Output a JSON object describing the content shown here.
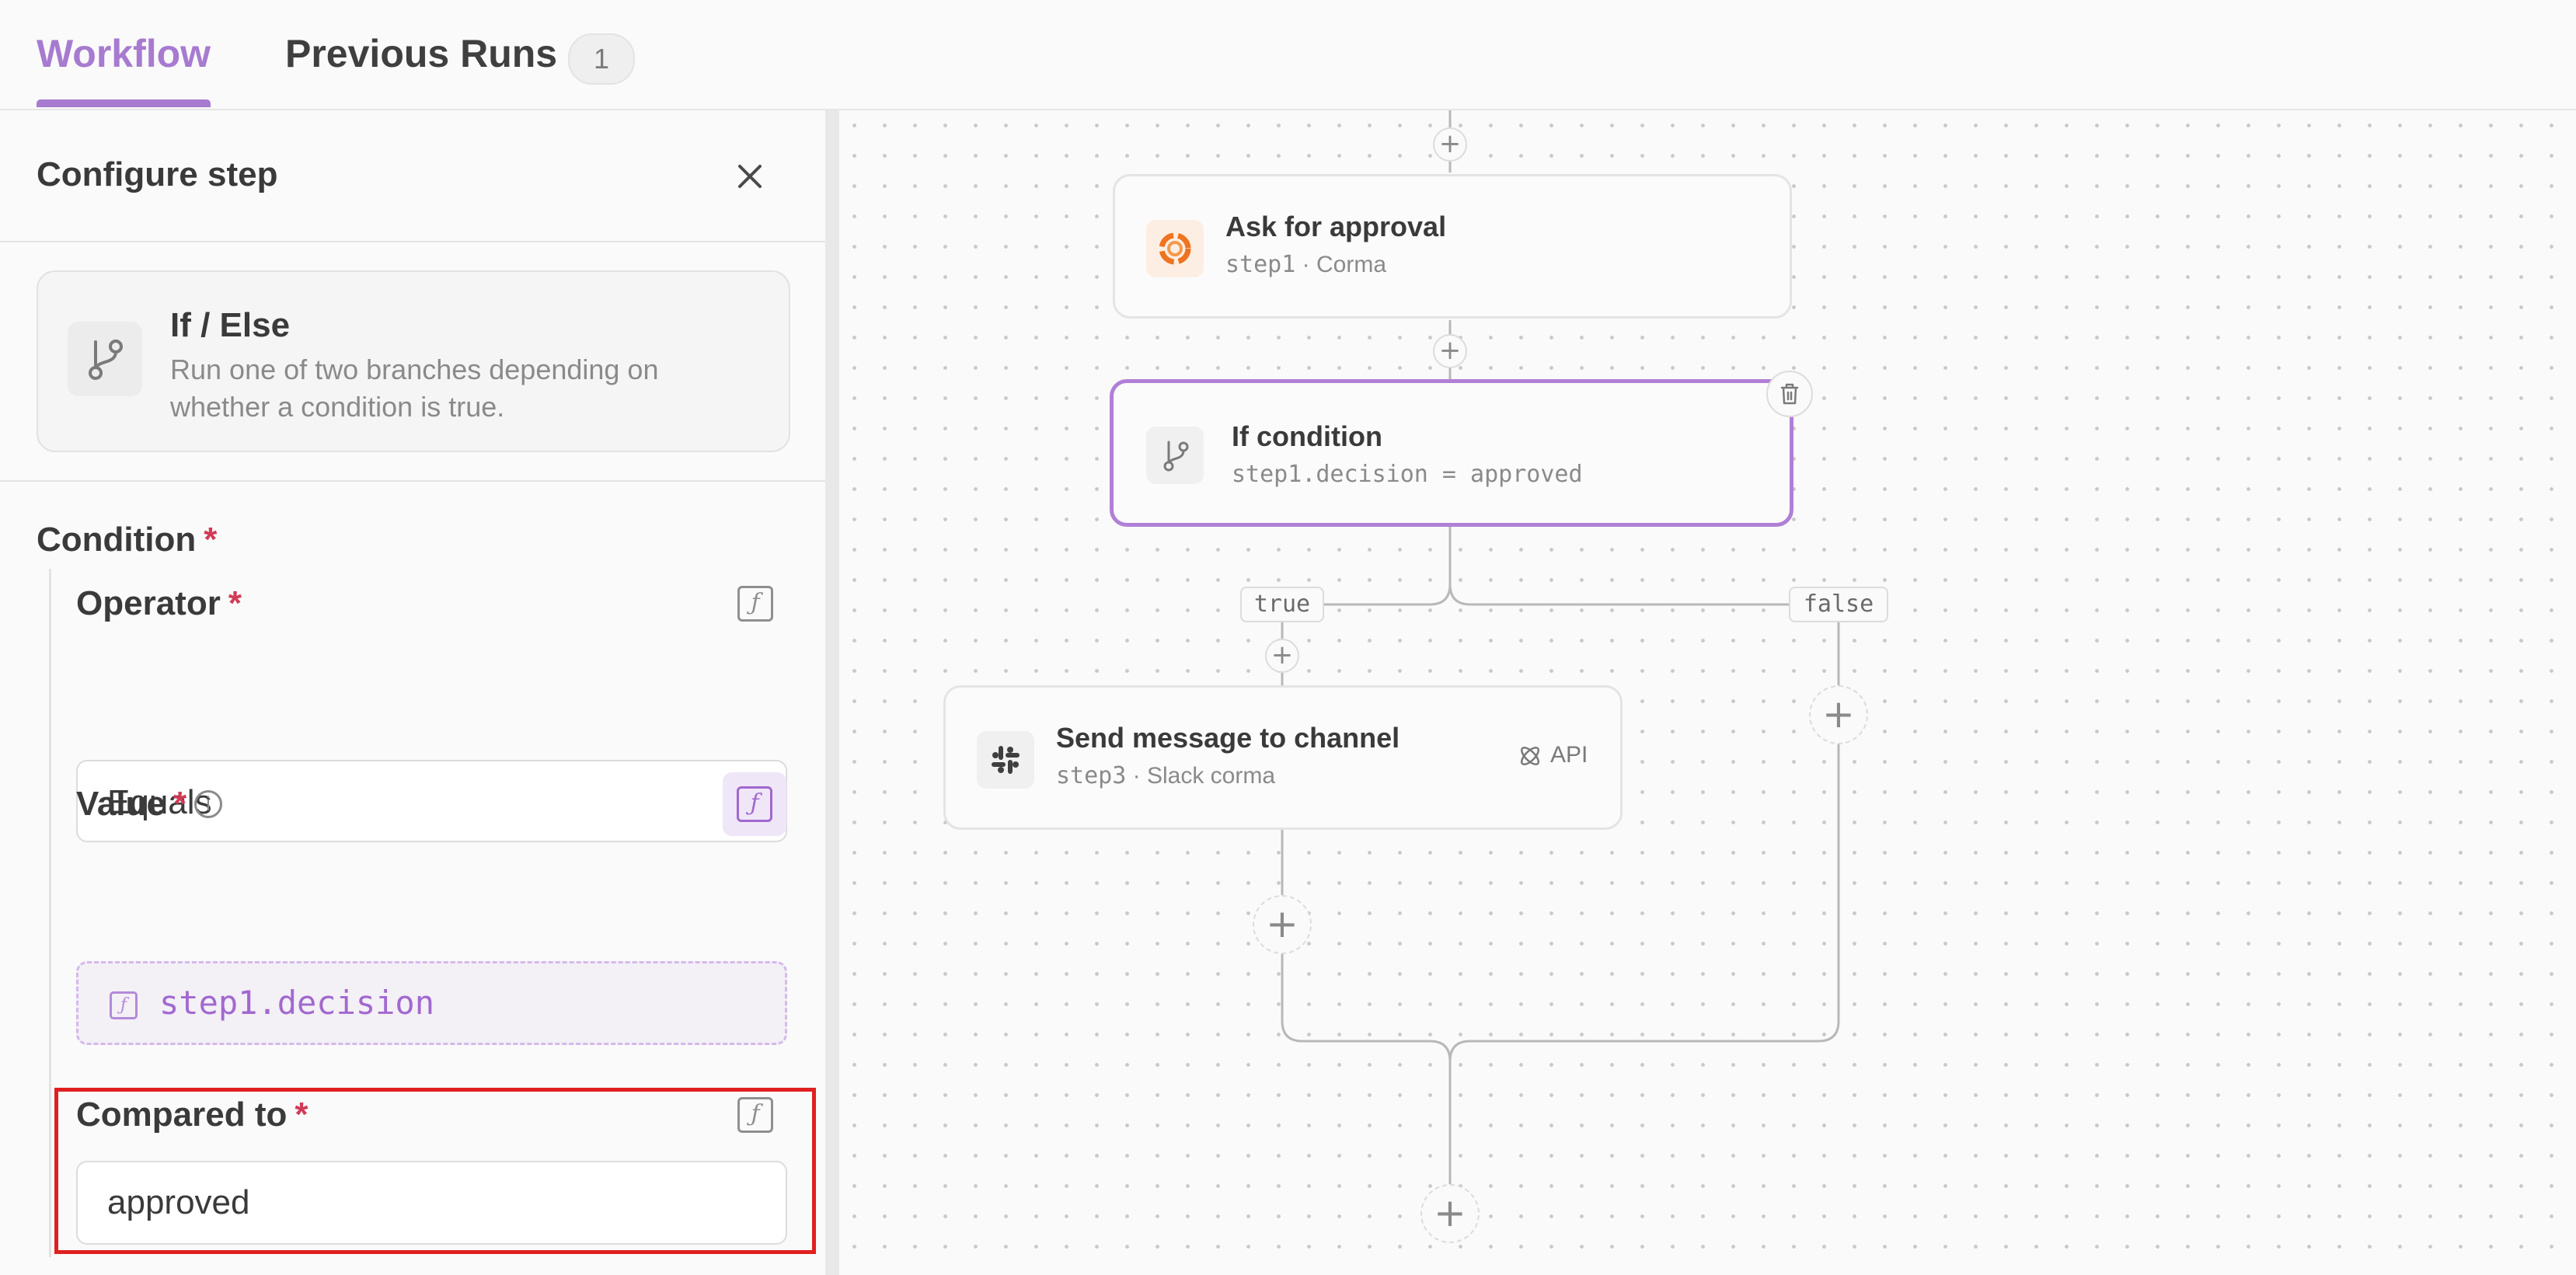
{
  "tabs": {
    "workflow": "Workflow",
    "previous_runs": "Previous Runs",
    "previous_runs_count": "1"
  },
  "panel": {
    "title": "Configure step",
    "step_type": {
      "title": "If / Else",
      "description": "Run one of two branches depending on whether a condition is true."
    },
    "condition_label": "Condition",
    "required_mark": "*",
    "operator": {
      "label": "Operator",
      "value": "Equals"
    },
    "value": {
      "label": "Value",
      "variable": "step1.decision"
    },
    "compared_to": {
      "label": "Compared to",
      "value": "approved"
    },
    "fx_symbol": "ƒ",
    "info_symbol": "i"
  },
  "canvas": {
    "nodes": [
      {
        "title": "Ask for approval",
        "step_id": "step1",
        "separator": " · ",
        "app": "Corma"
      },
      {
        "title": "If condition",
        "expression": "step1.decision = approved"
      },
      {
        "title": "Send message to channel",
        "step_id": "step3",
        "separator": " · ",
        "app": "Slack corma",
        "tag": "API"
      }
    ],
    "branch_true": "true",
    "branch_false": "false",
    "plus": "+"
  },
  "colors": {
    "accent": "#a67bd0",
    "highlight": "#e02020",
    "required": "#d13a56",
    "corma_orange": "#f0731f"
  },
  "icons": {
    "close": "close-icon",
    "branch": "git-branch-icon",
    "chevron": "chevron-down-icon",
    "function": "function-icon",
    "info": "info-icon",
    "corma": "corma-logo-icon",
    "slack": "slack-logo-icon",
    "api": "api-icon",
    "trash": "trash-icon"
  }
}
